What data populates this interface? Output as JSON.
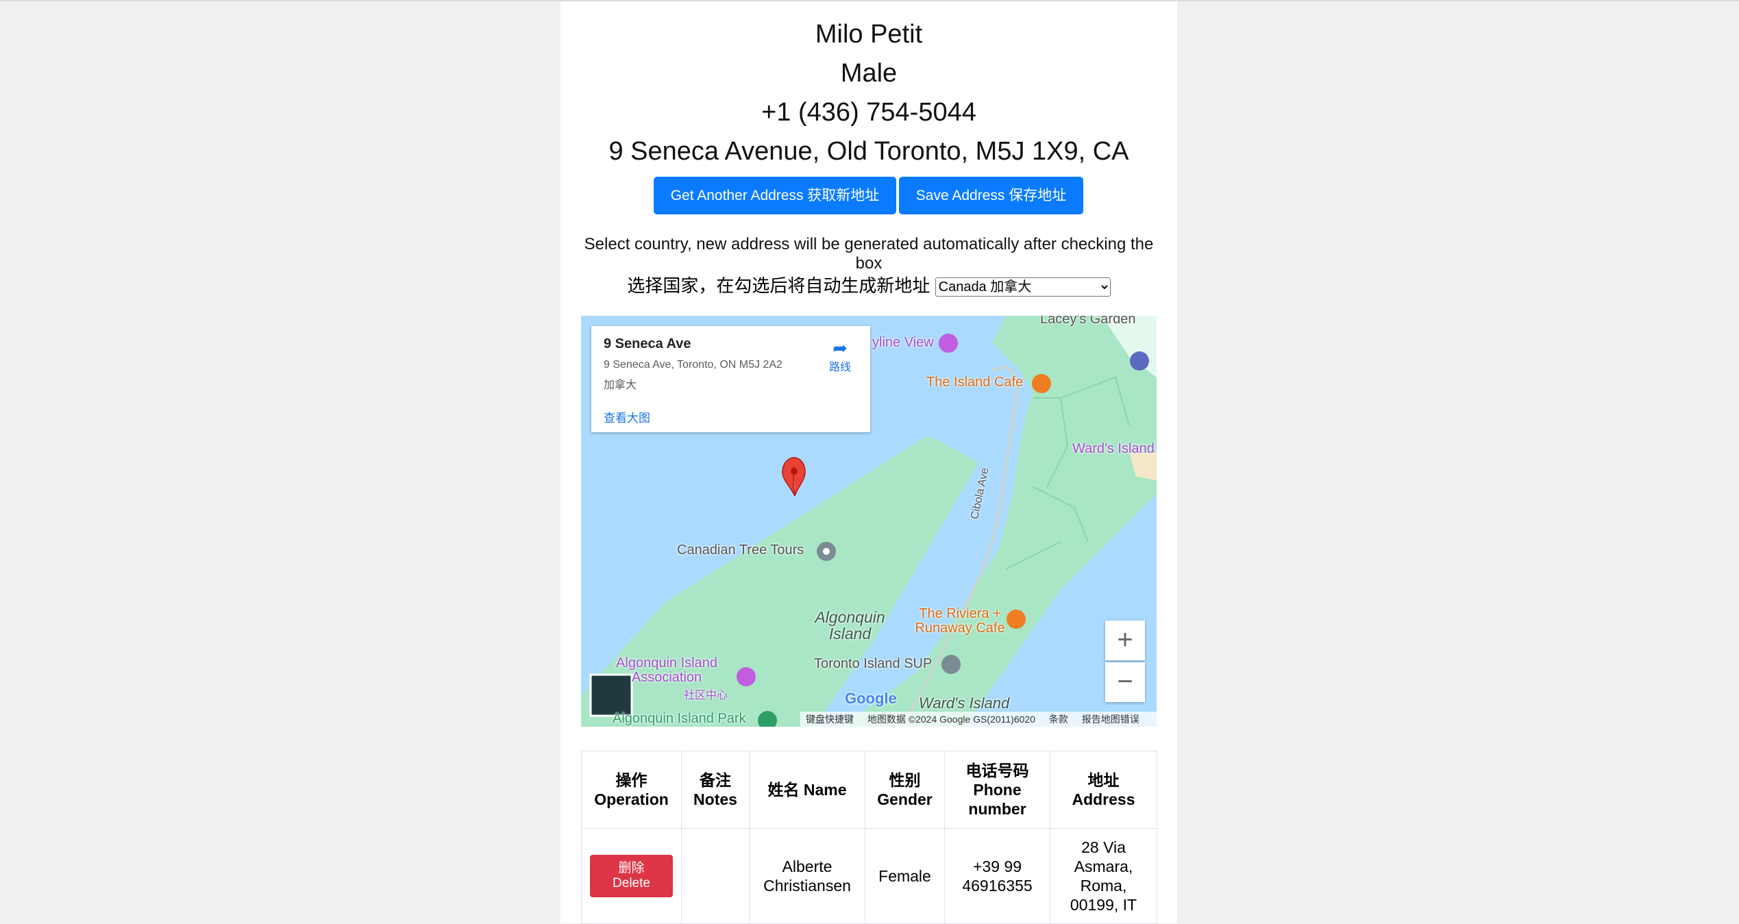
{
  "person": {
    "name": "Milo Petit",
    "gender": "Male",
    "phone": "+1 (436) 754-5044",
    "address": "9 Seneca Avenue, Old Toronto, M5J 1X9, CA"
  },
  "buttons": {
    "get_another": "Get Another Address 获取新地址",
    "save": "Save Address 保存地址"
  },
  "hint": {
    "en": "Select country, new address will be generated automatically after checking the box",
    "cn": "选择国家，在勾选后将自动生成新地址",
    "country_selected": "Canada 加拿大"
  },
  "map": {
    "card": {
      "title": "9 Seneca Ave",
      "address": "9 Seneca Ave, Toronto, ON M5J 2A2",
      "country": "加拿大",
      "directions": "路线",
      "view_larger": "查看大图"
    },
    "labels": {
      "skyline_view": "yline View",
      "island_cafe": "The Island Cafe",
      "wards_island_top": "Ward's Island",
      "cibola_ave": "Cibola Ave",
      "tree_tours": "Canadian Tree Tours",
      "algonquin_island": "Algonquin Island",
      "riviera_cafe": "The Riviera + Runaway Cafe",
      "association": "Algonquin Island Association",
      "community_center": "社区中心",
      "sup": "Toronto Island SUP",
      "wards_island_bottom": "Ward's Island",
      "algonquin_park": "Algonquin Island Park",
      "laceys_garden": "Lacey's Garden",
      "google": "Google"
    },
    "attribution": {
      "shortcuts": "键盘快捷键",
      "data": "地图数据 ©2024 Google GS(2011)6020",
      "terms": "条款",
      "report": "报告地图错误"
    },
    "zoom_in": "+",
    "zoom_out": "−",
    "colors": {
      "water": "#aadaff",
      "land": "#a8e6c5",
      "pin": "#ea4335"
    }
  },
  "table": {
    "headers": {
      "operation_cn": "操作",
      "operation_en": "Operation",
      "notes_cn": "备注",
      "notes_en": "Notes",
      "name": "姓名 Name",
      "gender_cn": "性别",
      "gender_en": "Gender",
      "phone_cn": "电话号码",
      "phone_en": "Phone number",
      "address_cn": "地址",
      "address_en": "Address"
    },
    "rows": [
      {
        "delete_cn": "删除",
        "delete_en": "Delete",
        "notes": "",
        "name": "Alberte Christiansen",
        "gender": "Female",
        "phone": "+39 99 46916355",
        "address": "28 Via Asmara, Roma, 00199, IT"
      }
    ]
  }
}
